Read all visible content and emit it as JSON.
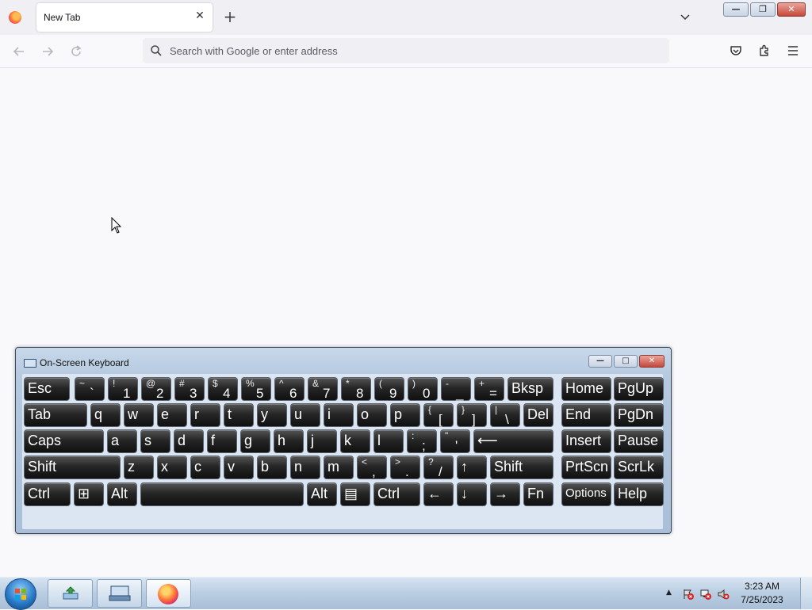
{
  "browser": {
    "tab_title": "New Tab",
    "tab_close": "✕",
    "new_tab": "+",
    "url_placeholder": "Search with Google or enter address",
    "window_buttons": {
      "minimize": "—",
      "maximize": "❐",
      "close": "✕"
    }
  },
  "osk": {
    "title": "On-Screen Keyboard",
    "window_buttons": {
      "minimize": "—",
      "maximize": "□",
      "close": "✕"
    },
    "keys": [
      {
        "id": "esc",
        "label": "Esc"
      },
      {
        "id": "tilde",
        "top": "~",
        "bot": "`"
      },
      {
        "id": "1",
        "top": "!",
        "bot": "1"
      },
      {
        "id": "2",
        "top": "@",
        "bot": "2"
      },
      {
        "id": "3",
        "top": "#",
        "bot": "3"
      },
      {
        "id": "4",
        "top": "$",
        "bot": "4"
      },
      {
        "id": "5",
        "top": "%",
        "bot": "5"
      },
      {
        "id": "6",
        "top": "^",
        "bot": "6"
      },
      {
        "id": "7",
        "top": "&",
        "bot": "7"
      },
      {
        "id": "8",
        "top": "*",
        "bot": "8"
      },
      {
        "id": "9",
        "top": "(",
        "bot": "9"
      },
      {
        "id": "0",
        "top": ")",
        "bot": "0"
      },
      {
        "id": "minus",
        "top": "-",
        "bot": "_"
      },
      {
        "id": "equals",
        "top": "+",
        "bot": "="
      },
      {
        "id": "bksp",
        "label": "Bksp"
      },
      {
        "id": "home",
        "label": "Home"
      },
      {
        "id": "pgup",
        "label": "PgUp"
      },
      {
        "id": "tab",
        "label": "Tab"
      },
      {
        "id": "q",
        "label": "q"
      },
      {
        "id": "w",
        "label": "w"
      },
      {
        "id": "e",
        "label": "e"
      },
      {
        "id": "r",
        "label": "r"
      },
      {
        "id": "t",
        "label": "t"
      },
      {
        "id": "y",
        "label": "y"
      },
      {
        "id": "u",
        "label": "u"
      },
      {
        "id": "i",
        "label": "i"
      },
      {
        "id": "o",
        "label": "o"
      },
      {
        "id": "p",
        "label": "p"
      },
      {
        "id": "lbracket",
        "top": "{",
        "bot": "["
      },
      {
        "id": "rbracket",
        "top": "}",
        "bot": "]"
      },
      {
        "id": "backslash",
        "top": "|",
        "bot": "\\"
      },
      {
        "id": "del",
        "label": "Del"
      },
      {
        "id": "end",
        "label": "End"
      },
      {
        "id": "pgdn",
        "label": "PgDn"
      },
      {
        "id": "caps",
        "label": "Caps"
      },
      {
        "id": "a",
        "label": "a"
      },
      {
        "id": "s",
        "label": "s"
      },
      {
        "id": "d",
        "label": "d"
      },
      {
        "id": "f",
        "label": "f"
      },
      {
        "id": "g",
        "label": "g"
      },
      {
        "id": "h",
        "label": "h"
      },
      {
        "id": "j",
        "label": "j"
      },
      {
        "id": "k",
        "label": "k"
      },
      {
        "id": "l",
        "label": "l"
      },
      {
        "id": "semicolon",
        "top": ":",
        "bot": ";"
      },
      {
        "id": "quote",
        "top": "\"",
        "bot": "'"
      },
      {
        "id": "enter",
        "label": "⟵"
      },
      {
        "id": "insert",
        "label": "Insert"
      },
      {
        "id": "pause",
        "label": "Pause"
      },
      {
        "id": "lshift",
        "label": "Shift"
      },
      {
        "id": "z",
        "label": "z"
      },
      {
        "id": "x",
        "label": "x"
      },
      {
        "id": "c",
        "label": "c"
      },
      {
        "id": "v",
        "label": "v"
      },
      {
        "id": "b",
        "label": "b"
      },
      {
        "id": "n",
        "label": "n"
      },
      {
        "id": "m",
        "label": "m"
      },
      {
        "id": "comma",
        "top": "<",
        "bot": ","
      },
      {
        "id": "period",
        "top": ">",
        "bot": "."
      },
      {
        "id": "slash",
        "top": "?",
        "bot": "/"
      },
      {
        "id": "up",
        "label": "↑"
      },
      {
        "id": "rshift",
        "label": "Shift"
      },
      {
        "id": "prtscn",
        "label": "PrtScn"
      },
      {
        "id": "scrlk",
        "label": "ScrLk"
      },
      {
        "id": "lctrl",
        "label": "Ctrl"
      },
      {
        "id": "win",
        "label": "⊞"
      },
      {
        "id": "lalt",
        "label": "Alt"
      },
      {
        "id": "space",
        "label": ""
      },
      {
        "id": "ralt",
        "label": "Alt"
      },
      {
        "id": "menu",
        "label": "▤"
      },
      {
        "id": "rctrl",
        "label": "Ctrl"
      },
      {
        "id": "left",
        "label": "←"
      },
      {
        "id": "down",
        "label": "↓"
      },
      {
        "id": "right",
        "label": "→"
      },
      {
        "id": "fn",
        "label": "Fn"
      },
      {
        "id": "options",
        "label": "Options"
      },
      {
        "id": "help",
        "label": "Help"
      }
    ]
  },
  "taskbar": {
    "time": "3:23 AM",
    "date": "7/25/2023",
    "tray_expand": "▲"
  },
  "colors": {
    "accent": "#0060df",
    "key_bg": "#1a1a1a",
    "osk_frame": "#b5c9df"
  }
}
